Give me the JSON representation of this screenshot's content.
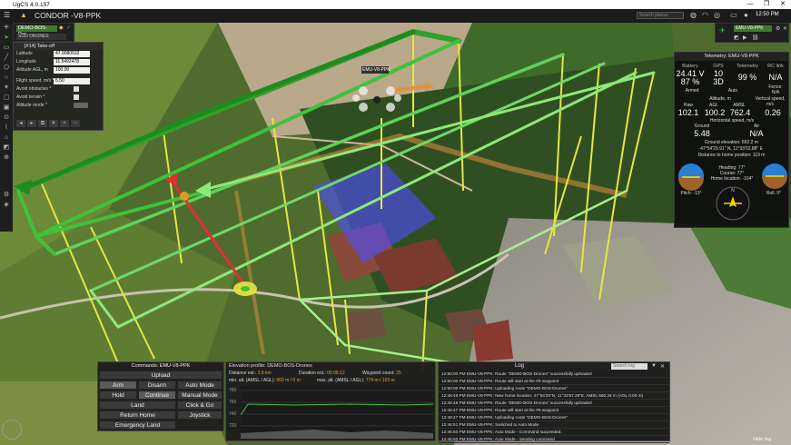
{
  "window": {
    "title": "UgCS 4.0.157",
    "controls": [
      "—",
      "❐",
      "✕"
    ]
  },
  "topbar": {
    "vehicle_name": "CONDOR -V8-PPK",
    "search_placeholder": "Search places",
    "clock": "12:50 PM"
  },
  "left_toolbar": {
    "icons": [
      "plus-icon",
      "cursor-icon",
      "rect-icon",
      "line-icon",
      "poly-icon",
      "circle-icon",
      "star-icon",
      "area-icon",
      "photo-icon",
      "pin-icon",
      "ruler-icon",
      "home-icon",
      "camera-icon",
      "target-icon",
      "settings-icon",
      "layers-icon"
    ]
  },
  "vehicle_tab": {
    "route": "DEMO-BOS-Dro...",
    "sub": "SOD DRONES"
  },
  "takeoff": {
    "header": "[#14] Take-off",
    "latitude_label": "Latitude",
    "latitude": "47.9080532",
    "longitude_label": "Longitude",
    "longitude": "11.5492478",
    "alt_label": "Altitude AGL, m",
    "alt": "100.00",
    "speed_label": "Flight speed, m/s *",
    "speed": "5.50",
    "avoid_obstacles": "Avoid obstacles *",
    "avoid_terrain": "Avoid terrain *",
    "altitude_mode": "Altitude mode *"
  },
  "right_tab": {
    "name": "EMU-V8-PPK"
  },
  "telemetry": {
    "header": "Telemetry: EMU-V8-PPK",
    "battery_label": "Battery",
    "battery_v": "24.41 V",
    "battery_p": "87 %",
    "gps_label": "GPS",
    "gps_sats": "10",
    "gps_fix": "3D",
    "telem_label": "Telemetry",
    "telem_val": "99 %",
    "rc_label": "RC link",
    "rc_val": "N/A",
    "armed": "Armed",
    "mode": "Auto",
    "fence_label": "Fence:",
    "fence_val": "N/A",
    "alt_header": "Altitude, m",
    "raw_label": "Raw",
    "raw": "102.1",
    "agl_label": "AGL",
    "agl": "100.2",
    "amsl_label": "AMSL",
    "amsl": "762.4",
    "vspeed_label": "Vertical speed, m/s",
    "vspeed": "0.26",
    "hspeed_header": "Horizontal speed, m/s",
    "ground_label": "Ground",
    "ground": "5.48",
    "air_label": "Air",
    "air": "N/A",
    "ground_elev": "Ground elevation: 662.2 m",
    "coords": "47°54'29.91\" N, 11°33'02.88\" E",
    "home_dist": "Distance to home position: 119 m",
    "heading": "Heading: 77°",
    "course": "Course: 77°",
    "home_loc": "Home location: -104°",
    "pitch": "Pitch: -13°",
    "roll": "Roll: 0°"
  },
  "drone_label": "EMU-V8-PPK",
  "commands": {
    "header": "Commands: EMU-V8-PPK",
    "upload": "Upload",
    "arm": "Arm",
    "disarm": "Disarm",
    "auto_mode": "Auto Mode",
    "hold": "Hold",
    "continue": "Continue",
    "manual_mode": "Manual Mode",
    "land": "Land",
    "click_go": "Click & Go",
    "return_home": "Return Home",
    "joystick": "Joystick",
    "emergency_land": "Emergency Land"
  },
  "elevation": {
    "header": "Elevation profile: DEMO-BOS-Drones",
    "dist_label": "Distance est.:",
    "dist": "2.8 km",
    "dur_label": "Duration est.:",
    "dur": "00:08:12",
    "wp_label": "Waypoint count:",
    "wp": "25",
    "min_label": "min. alt. (AMSL / AGL):",
    "min": "660 m / 0 m",
    "max_label": "max. alt. (AMSL / AGL):",
    "max": "774 m / 103 m",
    "ticks": [
      "780",
      "760",
      "740",
      "720"
    ]
  },
  "log": {
    "header": "Log",
    "search": "Search log",
    "entries": [
      "12:50:00 PM EMU-V8-PPK: Route \"DEMO-BOS-Drones\" successfully uploaded",
      "12:50:00 PM EMU-V8-PPK: Route will start at the #9 waypoint",
      "12:50:00 PM EMU-V8-PPK: Uploading route \"DEMO-BOS-Drones\"",
      "12:48:48 PM EMU-V8-PPK: New home location: 47°54'29\"N, 11°32'57.29\"E, AMSL 660.34 m (AGL 0.00 m)",
      "12:48:48 PM EMU-V8-PPK: Route \"DEMO-BOS-Drones\" successfully uploaded",
      "12:48:47 PM EMU-V8-PPK: Route will start at the #6 waypoint",
      "12:48:47 PM EMU-V8-PPK: Uploading route \"DEMO-BOS-Drones\"",
      "12:46:51 PM EMU-V8-PPK: Switched to Auto Mode",
      "12:46:50 PM EMU-V8-PPK: Auto Mode - Command succeeded.",
      "12:46:50 PM EMU-V8-PPK: Auto Mode - Sending command"
    ]
  },
  "hide_log": "Hide log",
  "colors": {
    "route_green": "#3fc23a",
    "route_light": "#8fe87a",
    "pillar_yellow": "#e6e640",
    "area_blue": "#4e4cff",
    "accent": "#3e7a2c"
  }
}
